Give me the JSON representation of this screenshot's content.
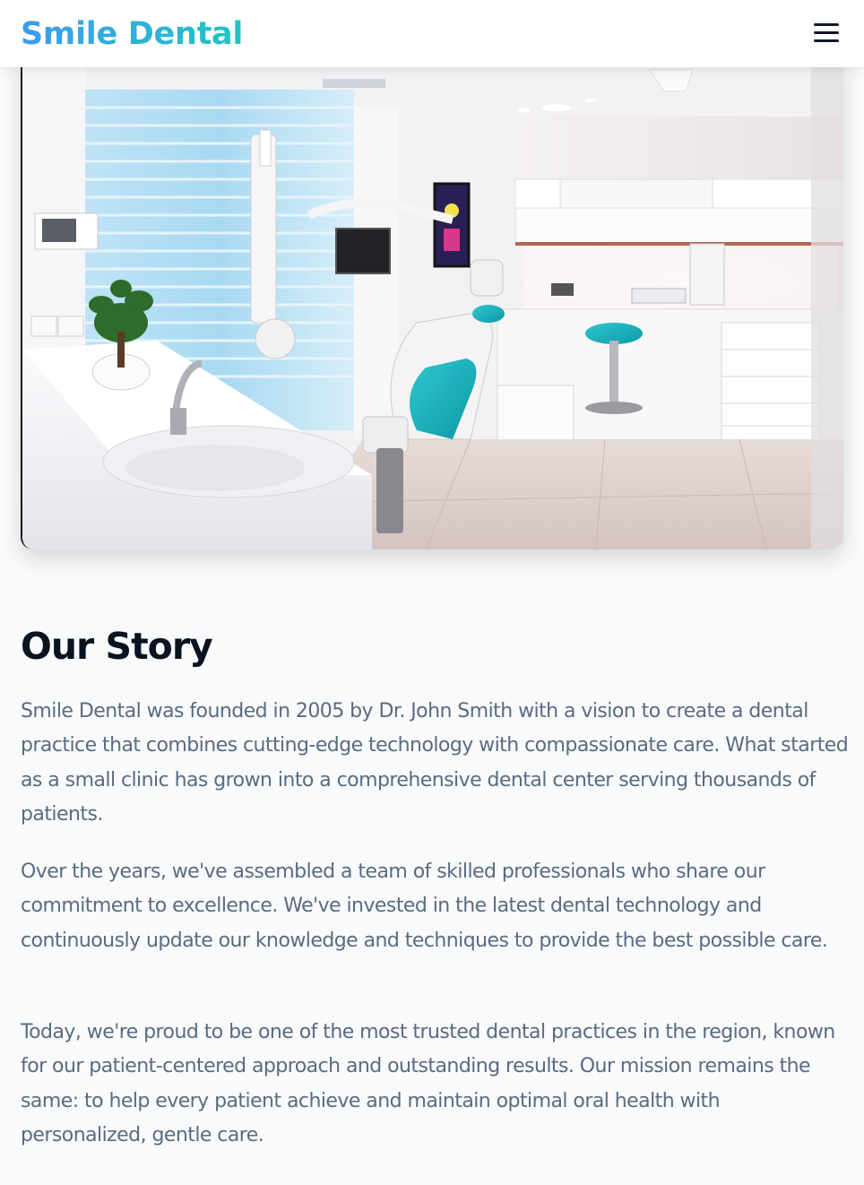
{
  "header": {
    "logo": "Smile Dental",
    "menu_icon": "hamburger-menu-icon"
  },
  "colors": {
    "logo_gradient_start": "#3b9cf0",
    "logo_gradient_end": "#20c5c2",
    "title": "#0b1220",
    "body_text": "#5b6b80",
    "page_background": "#f8fafc"
  },
  "story": {
    "title": "Our Story",
    "paragraphs": [
      "Smile Dental was founded in 2005 by Dr. John Smith with a vision to create a dental practice that combines cutting-edge technology with compassionate care. What started as a small clinic has grown into a comprehensive dental center serving thousands of patients.",
      "Over the years, we've assembled a team of skilled professionals who share our commitment to excellence. We've invested in the latest dental technology and continuously update our knowledge and techniques to provide the best possible care.",
      "Today, we're proud to be one of the most trusted dental practices in the region, known for our patient-centered approach and outstanding results. Our mission remains the same: to help every patient achieve and maintain optimal oral health with personalized, gentle care."
    ]
  }
}
